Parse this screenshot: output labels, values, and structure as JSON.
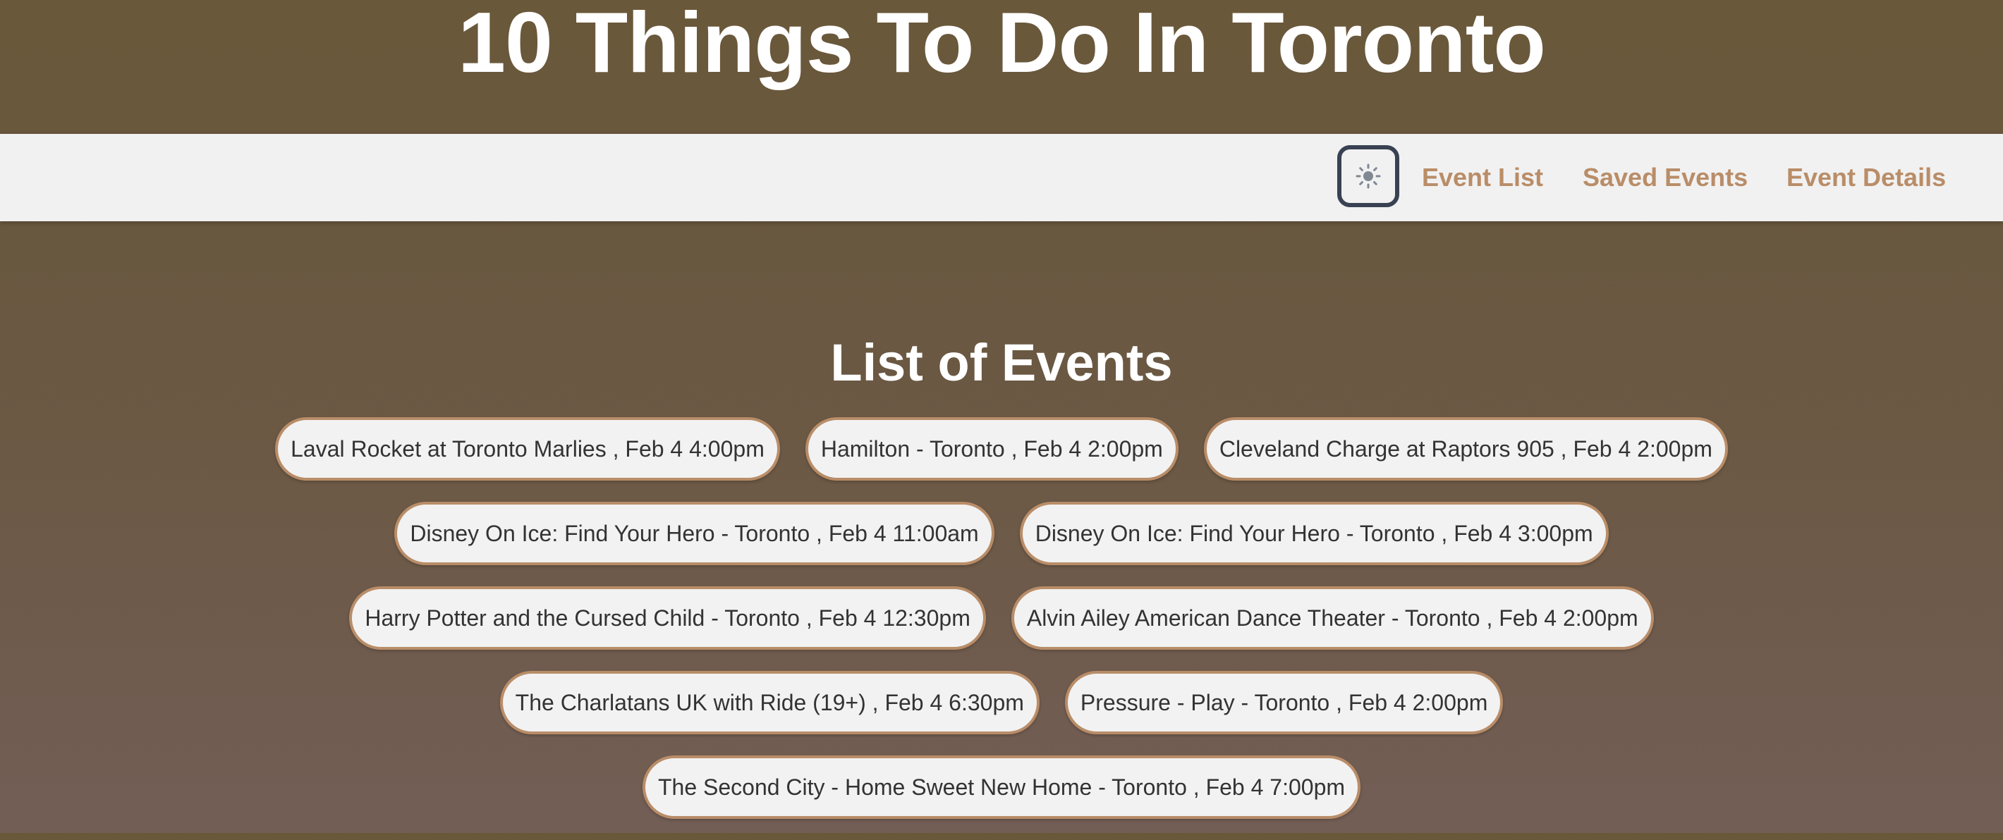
{
  "header": {
    "title": "10 Things To Do In Toronto"
  },
  "nav": {
    "theme_icon": "sun-icon",
    "links": [
      {
        "label": "Event List"
      },
      {
        "label": "Saved Events"
      },
      {
        "label": "Event Details"
      }
    ]
  },
  "main": {
    "section_title": "List of Events",
    "events": [
      "Laval Rocket at Toronto Marlies , Feb 4 4:00pm",
      "Hamilton - Toronto , Feb 4 2:00pm",
      "Cleveland Charge at Raptors 905 , Feb 4 2:00pm",
      "Disney On Ice: Find Your Hero - Toronto , Feb 4 11:00am",
      "Disney On Ice: Find Your Hero - Toronto , Feb 4 3:00pm",
      "Harry Potter and the Cursed Child - Toronto , Feb 4 12:30pm",
      "Alvin Ailey American Dance Theater - Toronto , Feb 4 2:00pm",
      "The Charlatans UK with Ride (19+) , Feb 4 6:30pm",
      "Pressure - Play - Toronto , Feb 4 2:00pm",
      "The Second City - Home Sweet New Home - Toronto , Feb 4 7:00pm"
    ]
  },
  "colors": {
    "accent": "#b98d68",
    "navbar_bg": "#f1f1f1",
    "toggle_border": "#394253",
    "pill_bg": "#f2f2f2",
    "text_dark": "#333333"
  }
}
